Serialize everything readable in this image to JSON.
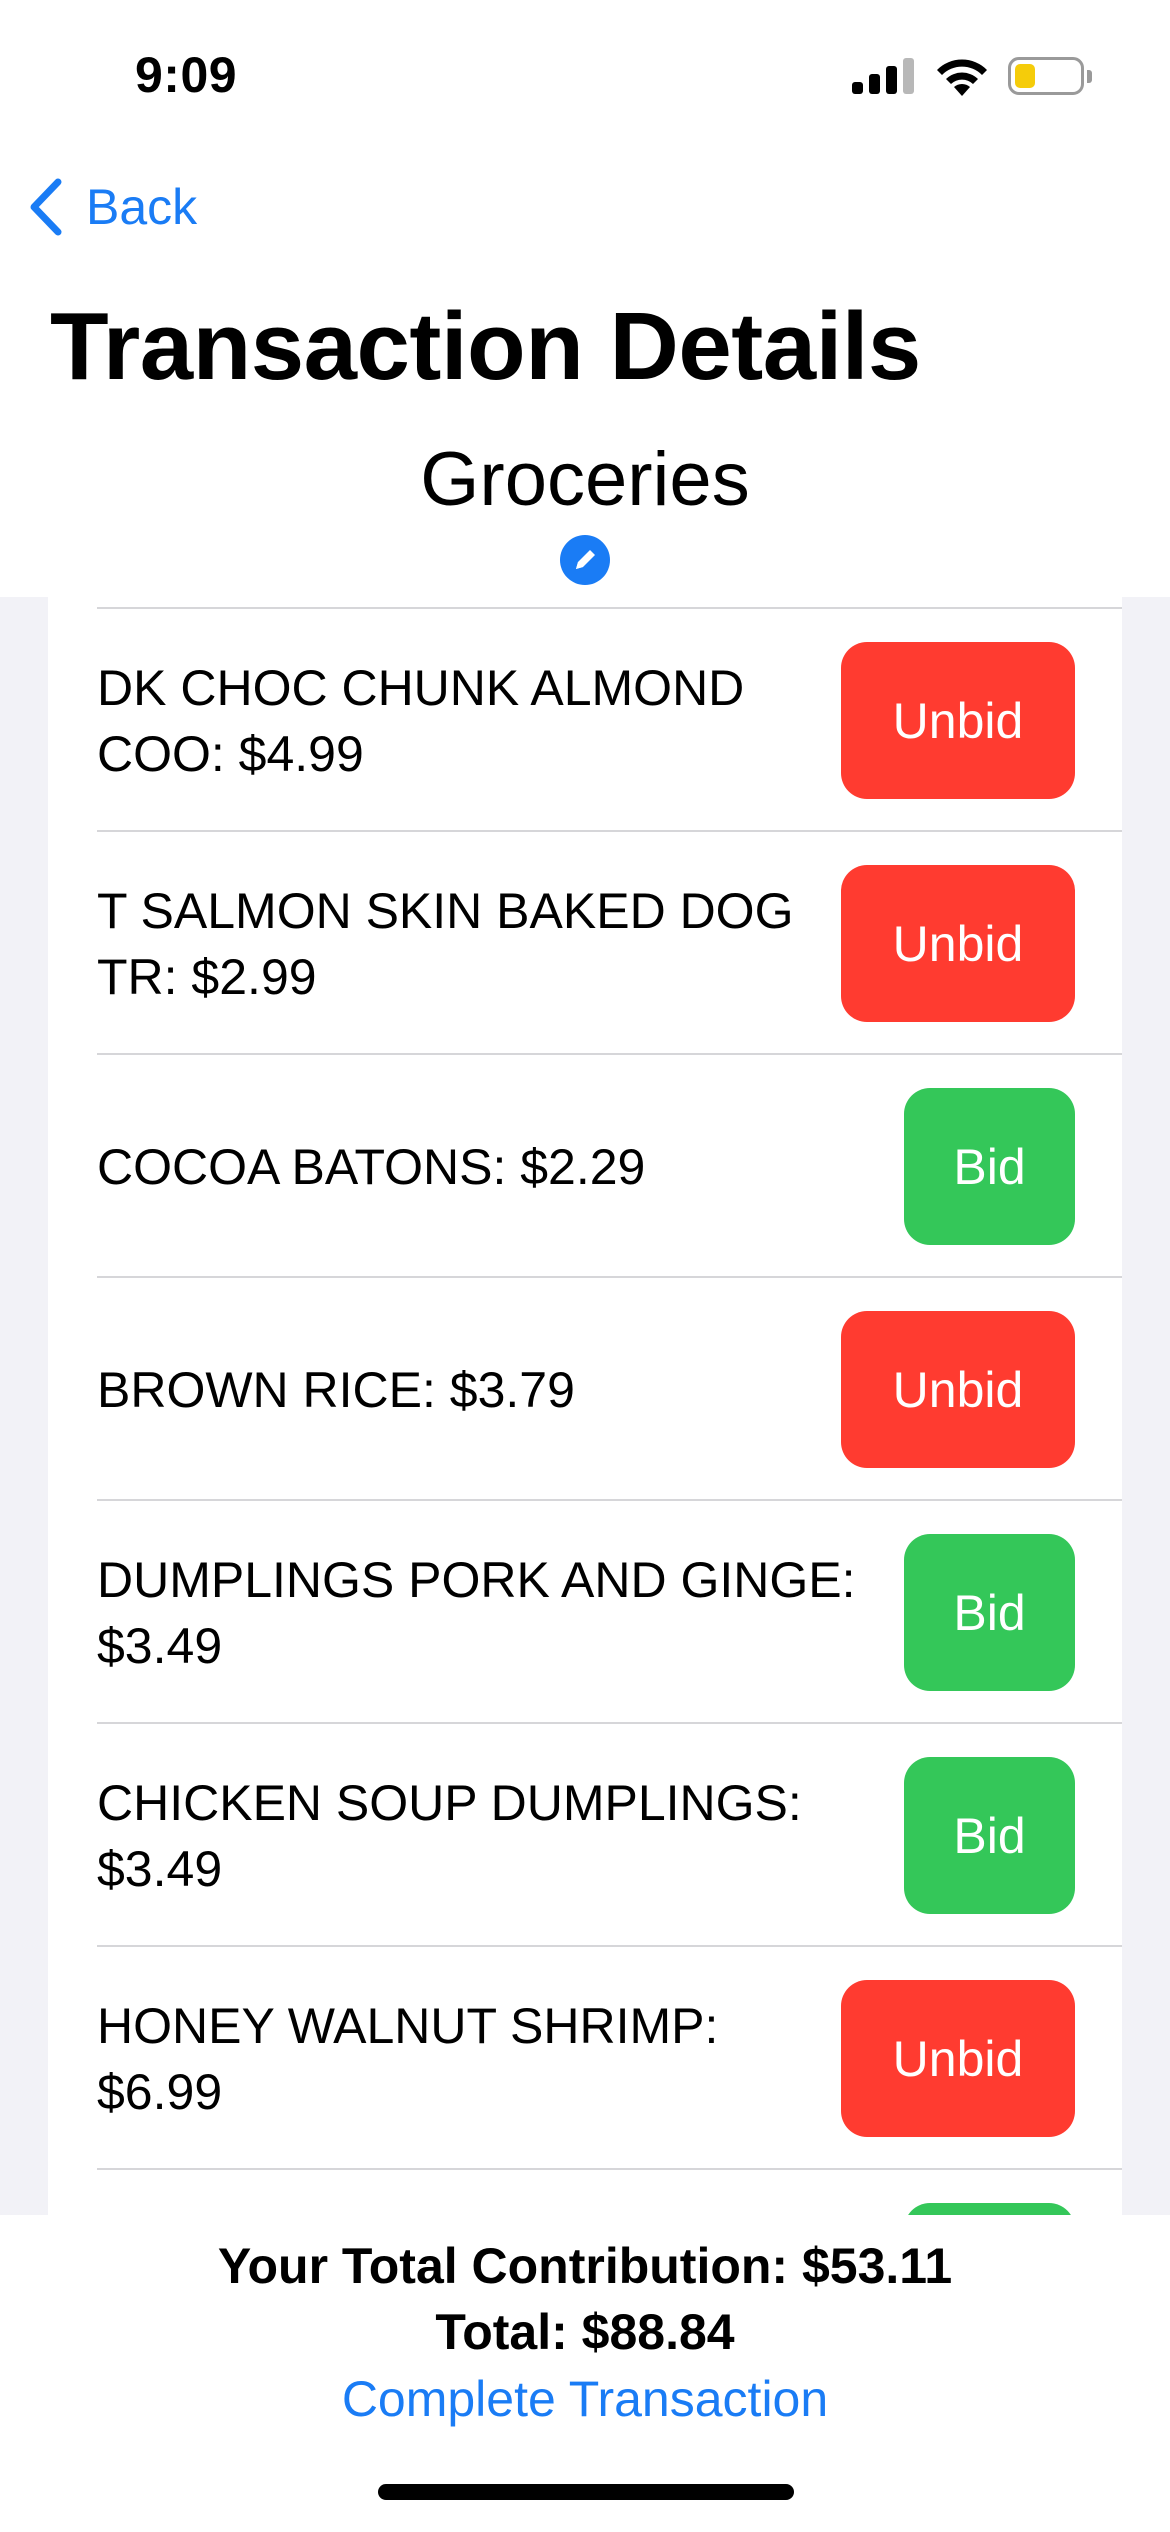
{
  "status_bar": {
    "time": "9:09",
    "battery_color": "#f5cc0a"
  },
  "nav": {
    "back_label": "Back"
  },
  "header": {
    "title": "Transaction Details",
    "subtitle": "Groceries"
  },
  "items": [
    {
      "line1": "DK CHOC CHUNK ALMOND",
      "line2": "COO: $4.99",
      "action": "Unbid"
    },
    {
      "line1": "T SALMON SKIN BAKED DOG",
      "line2": "TR: $2.99",
      "action": "Unbid"
    },
    {
      "line1": "COCOA BATONS: $2.29",
      "line2": "",
      "action": "Bid"
    },
    {
      "line1": "BROWN RICE: $3.79",
      "line2": "",
      "action": "Unbid"
    },
    {
      "line1": "DUMPLINGS PORK AND GINGE:",
      "line2": "$3.49",
      "action": "Bid"
    },
    {
      "line1": "CHICKEN SOUP DUMPLINGS:",
      "line2": "$3.49",
      "action": "Bid"
    },
    {
      "line1": "HONEY WALNUT SHRIMP:",
      "line2": "$6.99",
      "action": "Unbid"
    }
  ],
  "footer": {
    "contribution": "Your Total Contribution: $53.11",
    "total": "Total: $88.84",
    "complete_label": "Complete Transaction"
  },
  "colors": {
    "accent": "#1a7cf5",
    "unbid": "#ff3b30",
    "bid": "#34c759",
    "list_background": "#f2f2f7"
  }
}
